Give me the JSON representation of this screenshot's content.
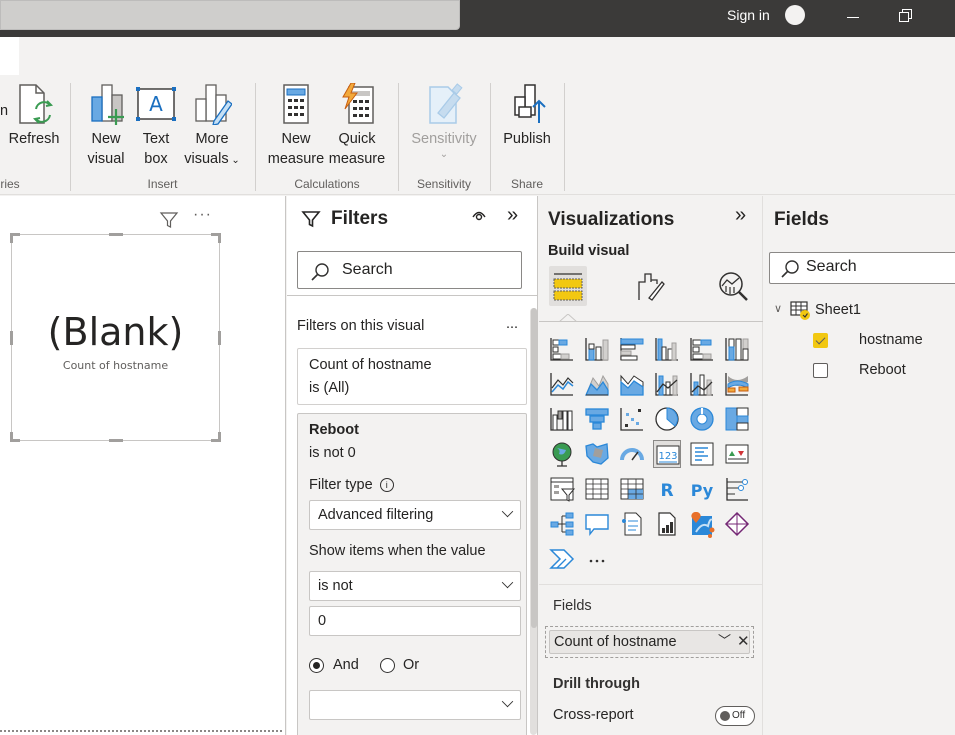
{
  "titlebar": {
    "signin_label": "Sign in"
  },
  "ribbon": {
    "buttons": {
      "refresh": "Refresh",
      "new_visual": [
        "New",
        "visual"
      ],
      "text_box": [
        "Text",
        "box"
      ],
      "more_visuals": [
        "More",
        "visuals"
      ],
      "new_measure": [
        "New",
        "measure"
      ],
      "quick_measure": [
        "Quick",
        "measure"
      ],
      "sensitivity": "Sensitivity",
      "publish": "Publish"
    },
    "groups": {
      "queries_partial": "ries",
      "insert": "Insert",
      "calculations": "Calculations",
      "sensitivity": "Sensitivity",
      "share": "Share"
    }
  },
  "canvas": {
    "card_value": "(Blank)",
    "card_label": "Count of hostname"
  },
  "filters": {
    "title": "Filters",
    "search_placeholder": "Search",
    "section_label": "Filters on this visual",
    "section_more": "...",
    "cards": [
      {
        "field": "Count of hostname",
        "state": "is (All)"
      },
      {
        "field": "Reboot",
        "state": "is not 0",
        "filter_type_label": "Filter type",
        "filter_type_value": "Advanced filtering",
        "show_items_label": "Show items when the value",
        "condition1_operator": "is not",
        "condition1_value": "0",
        "logic_and": "And",
        "logic_or": "Or",
        "logic_selected": "And",
        "condition2_operator": ""
      }
    ]
  },
  "visualizations": {
    "title": "Visualizations",
    "subtitle": "Build visual",
    "selected_tab": "build-visual",
    "gallery": [
      "stacked-bar-chart",
      "stacked-column-chart",
      "clustered-bar-chart",
      "clustered-column-chart",
      "100-stacked-bar-chart",
      "100-stacked-column-chart",
      "line-chart",
      "area-chart",
      "stacked-area-chart",
      "line-and-stacked-column-chart",
      "line-and-clustered-column-chart",
      "ribbon-chart",
      "waterfall-chart",
      "funnel",
      "scatter-chart",
      "pie-chart",
      "donut-chart",
      "treemap",
      "map",
      "filled-map",
      "gauge",
      "card",
      "multi-row-card",
      "kpi",
      "slicer",
      "table",
      "matrix",
      "r-script-visual",
      "python-visual",
      "key-influencers",
      "decomposition-tree",
      "q-and-a",
      "smart-narrative",
      "paginated-report",
      "azure-map",
      "power-apps",
      "power-automate",
      "more-visuals"
    ],
    "selected_visual": "card",
    "fields_well_label": "Fields",
    "fields_well_value": "Count of hostname",
    "drill_through_label": "Drill through",
    "cross_report_label": "Cross-report",
    "cross_report_toggle": "Off"
  },
  "fields_pane": {
    "title": "Fields",
    "search_placeholder": "Search",
    "tables": [
      {
        "name": "Sheet1",
        "expanded": true,
        "fields": [
          {
            "name": "hostname",
            "checked": true
          },
          {
            "name": "Reboot",
            "checked": false
          }
        ]
      }
    ]
  },
  "colors": {
    "accent_yellow": "#F2C811",
    "viz_blue": "#2b88d8",
    "titlebar_bg": "#3b3a39"
  }
}
